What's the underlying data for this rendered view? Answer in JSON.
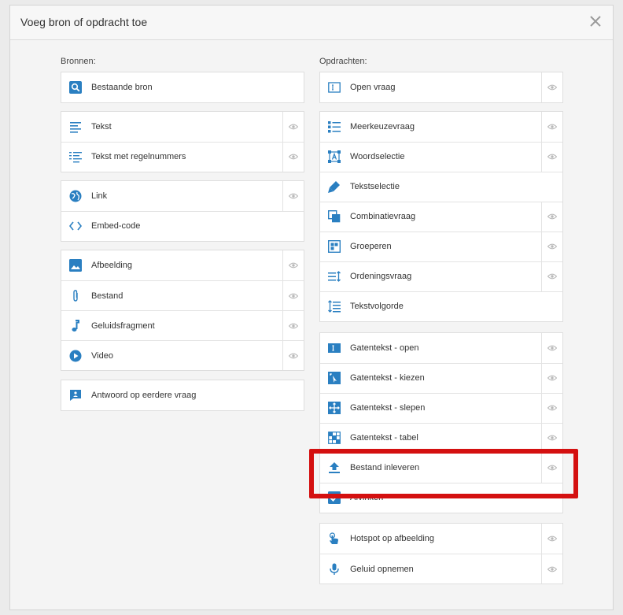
{
  "dialog": {
    "title": "Voeg bron of opdracht toe"
  },
  "colors": {
    "accent": "#2a7fc1",
    "highlight": "#d41010"
  },
  "sources": {
    "label": "Bronnen:",
    "groups": [
      [
        {
          "label": "Bestaande bron",
          "icon": "search-icon",
          "eye": false
        }
      ],
      [
        {
          "label": "Tekst",
          "icon": "text-icon",
          "eye": true
        },
        {
          "label": "Tekst met regelnummers",
          "icon": "numbered-text-icon",
          "eye": true
        }
      ],
      [
        {
          "label": "Link",
          "icon": "globe-icon",
          "eye": true
        },
        {
          "label": "Embed-code",
          "icon": "code-icon",
          "eye": false
        }
      ],
      [
        {
          "label": "Afbeelding",
          "icon": "image-icon",
          "eye": true
        },
        {
          "label": "Bestand",
          "icon": "paperclip-icon",
          "eye": true
        },
        {
          "label": "Geluidsfragment",
          "icon": "music-note-icon",
          "eye": true
        },
        {
          "label": "Video",
          "icon": "play-icon",
          "eye": true
        }
      ],
      [
        {
          "label": "Antwoord op eerdere vraag",
          "icon": "answer-icon",
          "eye": false
        }
      ]
    ]
  },
  "assignments": {
    "label": "Opdrachten:",
    "groups": [
      [
        {
          "label": "Open vraag",
          "icon": "open-question-icon",
          "eye": true
        }
      ],
      [
        {
          "label": "Meerkeuzevraag",
          "icon": "multiple-choice-icon",
          "eye": true
        },
        {
          "label": "Woordselectie",
          "icon": "word-selection-icon",
          "eye": true
        },
        {
          "label": "Tekstselectie",
          "icon": "marker-icon",
          "eye": false
        },
        {
          "label": "Combinatievraag",
          "icon": "combination-icon",
          "eye": true
        },
        {
          "label": "Groeperen",
          "icon": "grouping-icon",
          "eye": true
        },
        {
          "label": "Ordeningsvraag",
          "icon": "ordering-icon",
          "eye": true
        },
        {
          "label": "Tekstvolgorde",
          "icon": "text-order-icon",
          "eye": false
        }
      ],
      [
        {
          "label": "Gatentekst - open",
          "icon": "gap-open-icon",
          "eye": true
        },
        {
          "label": "Gatentekst - kiezen",
          "icon": "gap-choose-icon",
          "eye": true
        },
        {
          "label": "Gatentekst - slepen",
          "icon": "gap-drag-icon",
          "eye": true
        },
        {
          "label": "Gatentekst - tabel",
          "icon": "gap-table-icon",
          "eye": true
        },
        {
          "label": "Bestand inleveren",
          "icon": "upload-icon",
          "eye": true
        },
        {
          "label": "Afvinken",
          "icon": "checkbox-icon",
          "eye": false
        }
      ],
      [
        {
          "label": "Hotspot op afbeelding",
          "icon": "hotspot-icon",
          "eye": true
        },
        {
          "label": "Geluid opnemen",
          "icon": "microphone-icon",
          "eye": true
        }
      ]
    ]
  }
}
